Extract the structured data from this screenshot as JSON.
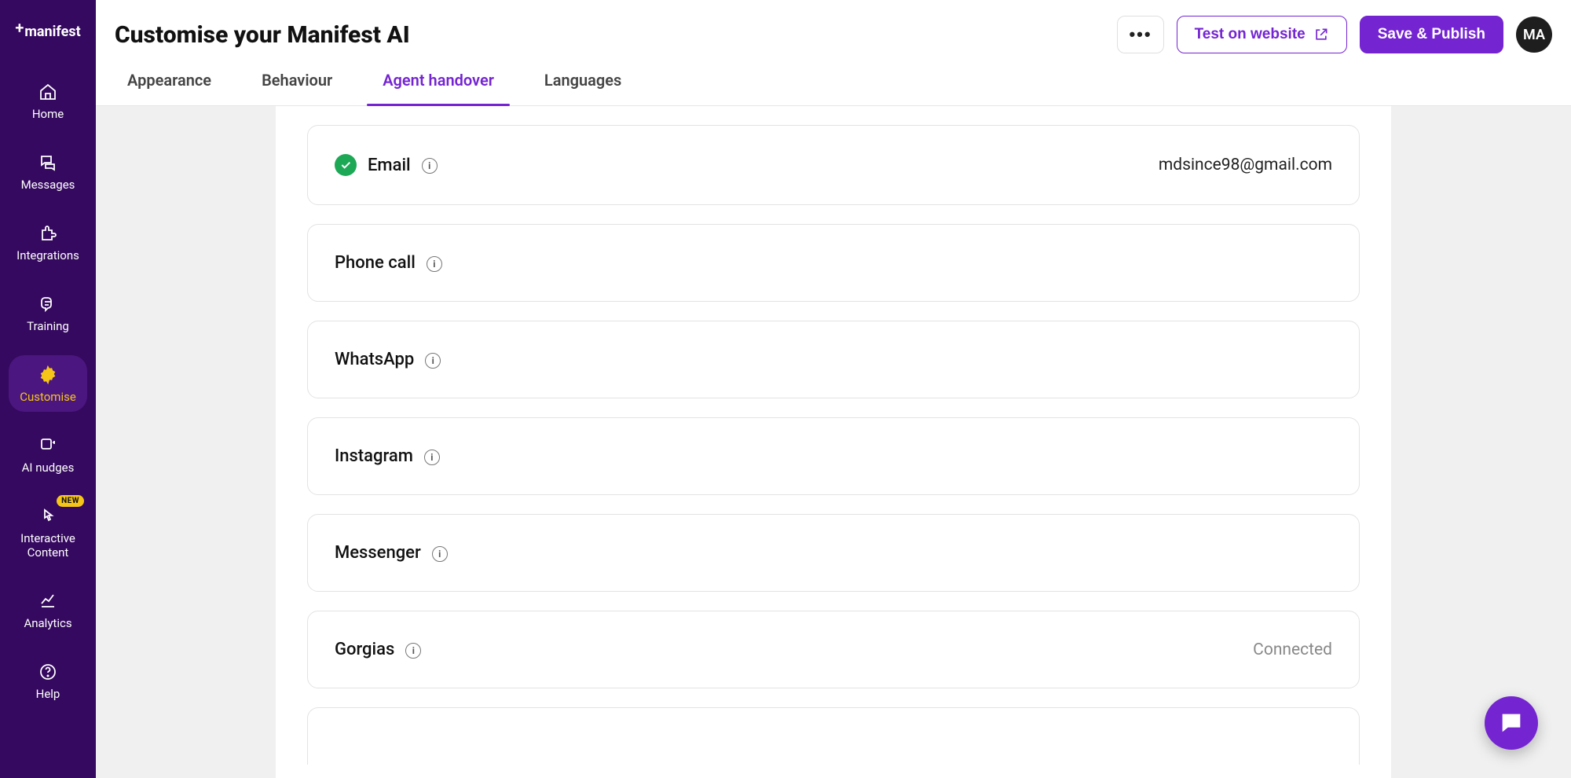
{
  "brand": "manifest",
  "sidebar": {
    "items": [
      {
        "id": "home",
        "label": "Home"
      },
      {
        "id": "messages",
        "label": "Messages"
      },
      {
        "id": "integrations",
        "label": "Integrations"
      },
      {
        "id": "training",
        "label": "Training"
      },
      {
        "id": "customise",
        "label": "Customise"
      },
      {
        "id": "ai-nudges",
        "label": "AI nudges"
      },
      {
        "id": "interactive-content",
        "label": "Interactive Content",
        "badge": "NEW"
      },
      {
        "id": "analytics",
        "label": "Analytics"
      },
      {
        "id": "help",
        "label": "Help"
      }
    ],
    "active": "customise"
  },
  "header": {
    "title": "Customise your Manifest AI",
    "test_button": "Test on website",
    "publish_button": "Save & Publish",
    "avatar_initials": "MA"
  },
  "tabs": [
    {
      "id": "appearance",
      "label": "Appearance"
    },
    {
      "id": "behaviour",
      "label": "Behaviour"
    },
    {
      "id": "agent-handover",
      "label": "Agent handover"
    },
    {
      "id": "languages",
      "label": "Languages"
    }
  ],
  "active_tab": "agent-handover",
  "channels": [
    {
      "id": "email",
      "label": "Email",
      "checked": true,
      "value": "mdsince98@gmail.com"
    },
    {
      "id": "phone",
      "label": "Phone call"
    },
    {
      "id": "whatsapp",
      "label": "WhatsApp"
    },
    {
      "id": "instagram",
      "label": "Instagram"
    },
    {
      "id": "messenger",
      "label": "Messenger"
    },
    {
      "id": "gorgias",
      "label": "Gorgias",
      "value": "Connected",
      "muted": true
    }
  ]
}
